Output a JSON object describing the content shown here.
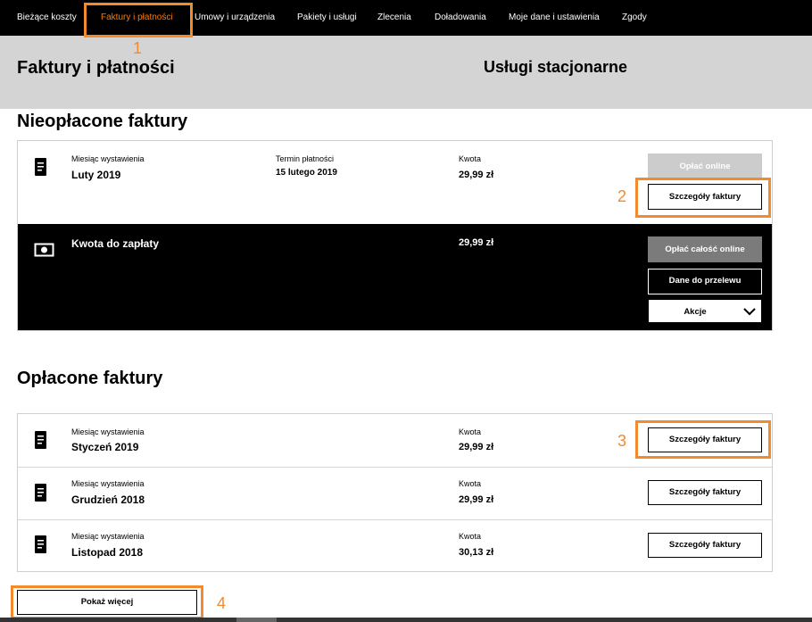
{
  "nav": {
    "items": [
      "Bieżące koszty",
      "Faktury i płatności",
      "Umowy i urządzenia",
      "Pakiety i usługi",
      "Zlecenia",
      "Doładowania",
      "Moje dane i ustawienia",
      "Zgody"
    ],
    "active_index": 1
  },
  "header": {
    "title": "Faktury i płatności",
    "subtitle": "Usługi stacjonarne"
  },
  "unpaid": {
    "section_title": "Nieopłacone faktury",
    "invoice": {
      "month_label": "Miesiąc wystawienia",
      "month": "Luty 2019",
      "due_label": "Termin płatności",
      "due": "15 lutego 2019",
      "amount_label": "Kwota",
      "amount": "29,99 zł",
      "pay_online": "Opłać online",
      "details": "Szczegóły faktury"
    },
    "total": {
      "label": "Kwota do zapłaty",
      "amount": "29,99 zł",
      "pay_all": "Opłać całość online",
      "transfer": "Dane do przelewu",
      "actions": "Akcje"
    }
  },
  "paid": {
    "section_title": "Opłacone faktury",
    "rows": [
      {
        "month_label": "Miesiąc wystawienia",
        "month": "Styczeń 2019",
        "amount_label": "Kwota",
        "amount": "29,99 zł",
        "details": "Szczegóły faktury"
      },
      {
        "month_label": "Miesiąc wystawienia",
        "month": "Grudzień 2018",
        "amount_label": "Kwota",
        "amount": "29,99 zł",
        "details": "Szczegóły faktury"
      },
      {
        "month_label": "Miesiąc wystawienia",
        "month": "Listopad 2018",
        "amount_label": "Kwota",
        "amount": "30,13 zł",
        "details": "Szczegóły faktury"
      }
    ],
    "show_more": "Pokaż więcej"
  },
  "annotations": [
    "1",
    "2",
    "3",
    "4"
  ],
  "colors": {
    "accent": "#ff7900",
    "annotation": "#f28a2e",
    "nav_bg": "#000000",
    "header_bg": "#d4d4d4"
  }
}
